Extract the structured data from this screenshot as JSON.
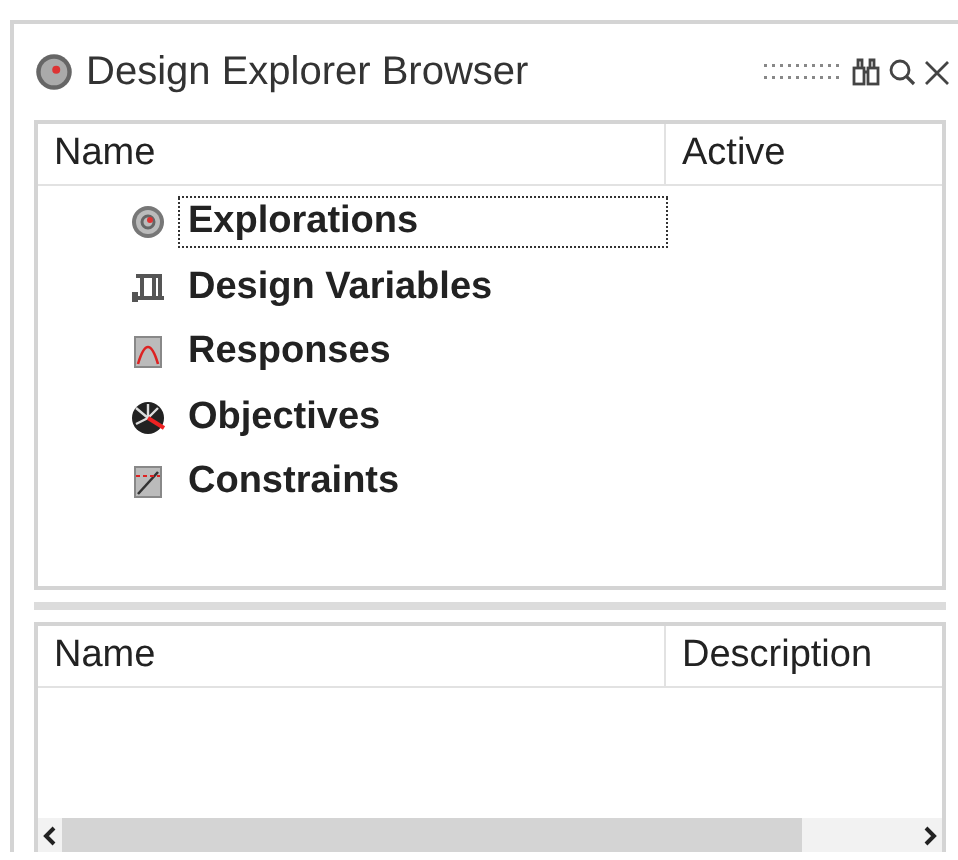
{
  "panel": {
    "title": "Design Explorer Browser"
  },
  "tree": {
    "columns": [
      "Name",
      "Active"
    ],
    "items": [
      {
        "label": "Explorations",
        "kind": "exploration",
        "selected": true
      },
      {
        "label": "Design Variables",
        "kind": "variable",
        "selected": false
      },
      {
        "label": "Responses",
        "kind": "response",
        "selected": false
      },
      {
        "label": "Objectives",
        "kind": "objective",
        "selected": false
      },
      {
        "label": "Constraints",
        "kind": "constraint",
        "selected": false
      }
    ]
  },
  "details": {
    "columns": [
      "Name",
      "Description"
    ]
  }
}
